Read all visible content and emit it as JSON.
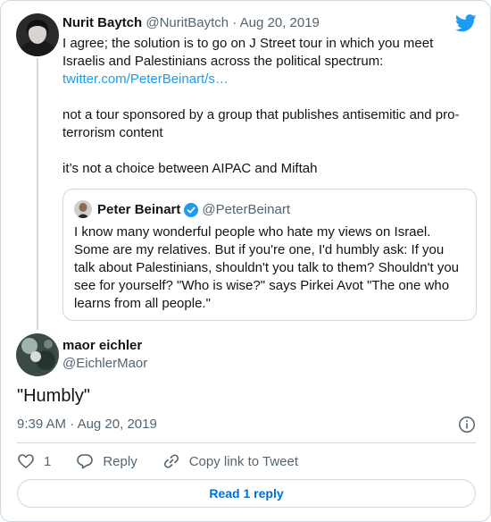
{
  "parent_tweet": {
    "author_name": "Nurit Baytch",
    "author_handle": "@NuritBaytch",
    "separator": "·",
    "date": "Aug 20, 2019",
    "paragraph_1": "I agree; the solution is to go on J Street tour in which you meet Israelis and Palestinians across the political spectrum:",
    "link": "twitter.com/PeterBeinart/s…",
    "paragraph_2": "not a tour sponsored by a group that publishes antisemitic and pro-terrorism content",
    "paragraph_3": "it’s not a choice between AIPAC and Miftah"
  },
  "quoted_tweet": {
    "author_name": "Peter Beinart",
    "author_handle": "@PeterBeinart",
    "text": "I know many wonderful people who hate my views on Israel. Some are my relatives. But if you're one, I'd humbly ask: If you talk about Palestinians, shouldn't you talk to them? Shouldn't you see for yourself? \"Who is wise?\" says Pirkei Avot \"The one who learns from all people.\""
  },
  "main_tweet": {
    "author_name": "maor eichler",
    "author_handle": "@EichlerMaor",
    "text": "\"Humbly\"",
    "time": "9:39 AM",
    "separator": "·",
    "date": "Aug 20, 2019"
  },
  "actions": {
    "like_count": "1",
    "reply_label": "Reply",
    "copy_link_label": "Copy link to Tweet"
  },
  "read_replies_label": "Read 1 reply",
  "colors": {
    "link": "#1d9bf0",
    "muted_text": "#536471",
    "border": "#cfd9de",
    "button_text": "#006fd6"
  },
  "icons": [
    "twitter-bird-icon",
    "verified-badge-icon",
    "info-icon",
    "heart-icon",
    "reply-icon",
    "link-icon"
  ]
}
